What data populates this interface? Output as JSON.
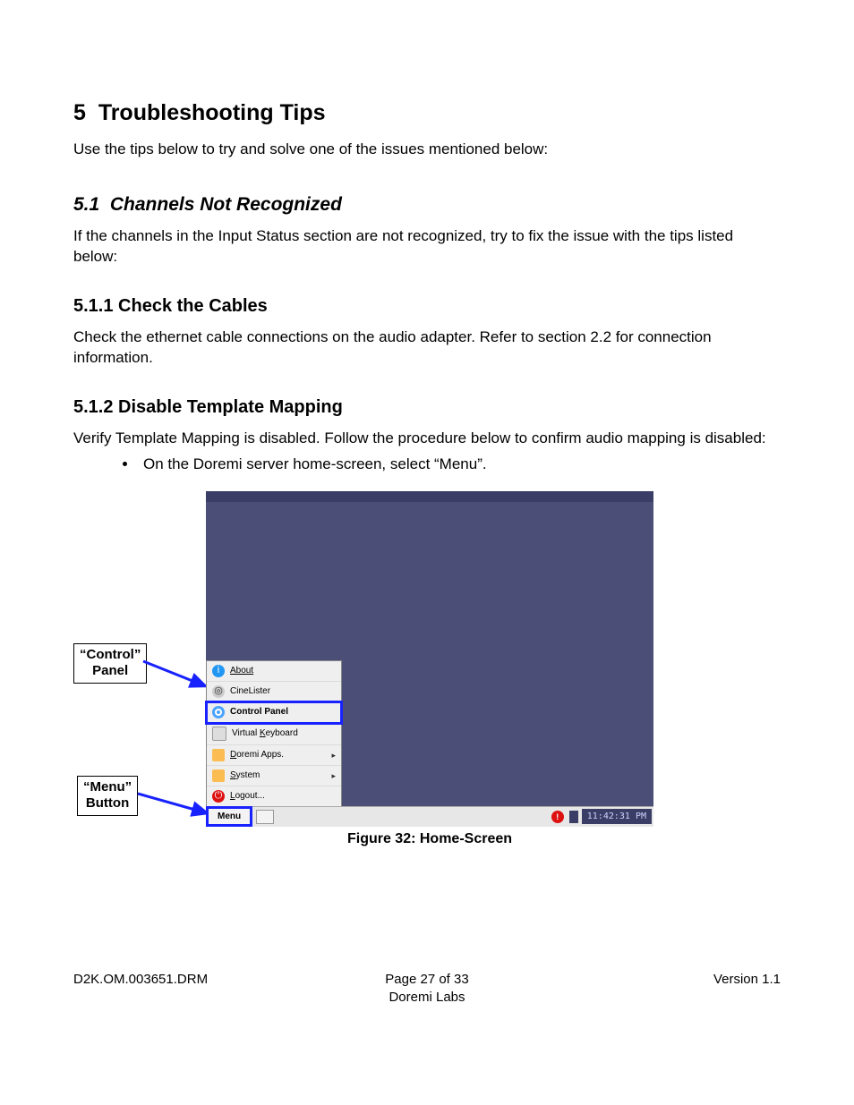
{
  "headings": {
    "h1_num": "5",
    "h1_txt": "Troubleshooting Tips",
    "h2_num": "5.1",
    "h2_txt": "Channels Not Recognized",
    "h3a_num": "5.1.1",
    "h3a_txt": "Check the Cables",
    "h3b_num": "5.1.2",
    "h3b_txt": "Disable Template Mapping"
  },
  "paragraphs": {
    "p1": "Use the tips below to try and solve one of the issues mentioned below:",
    "p2": "If the channels in the Input Status section are not recognized, try to fix the issue with the tips listed below:",
    "p3": "Check the ethernet cable connections on the audio adapter. Refer to section 2.2 for connection information.",
    "p4": "Verify Template Mapping is disabled. Follow the procedure below to confirm audio mapping is disabled:",
    "bullet1": "On the Doremi server home-screen, select “Menu”."
  },
  "callouts": {
    "control_l1": "“Control”",
    "control_l2": "Panel",
    "menu_l1": "“Menu”",
    "menu_l2": "Button"
  },
  "menu_items": {
    "about": "About",
    "cinelister": "CineLister",
    "control_panel": "Control Panel",
    "virtual_keyboard": "Virtual Keyboard",
    "doremi_apps": "Doremi Apps.",
    "system": "System",
    "logout": "Logout..."
  },
  "taskbar": {
    "menu_button": "Menu",
    "clock": "11:42:31 PM"
  },
  "figure_caption": "Figure 32: Home-Screen",
  "footer": {
    "left": "D2K.OM.003651.DRM",
    "mid_line1": "Page 27 of 33",
    "mid_line2": "Doremi Labs",
    "right": "Version 1.1"
  }
}
